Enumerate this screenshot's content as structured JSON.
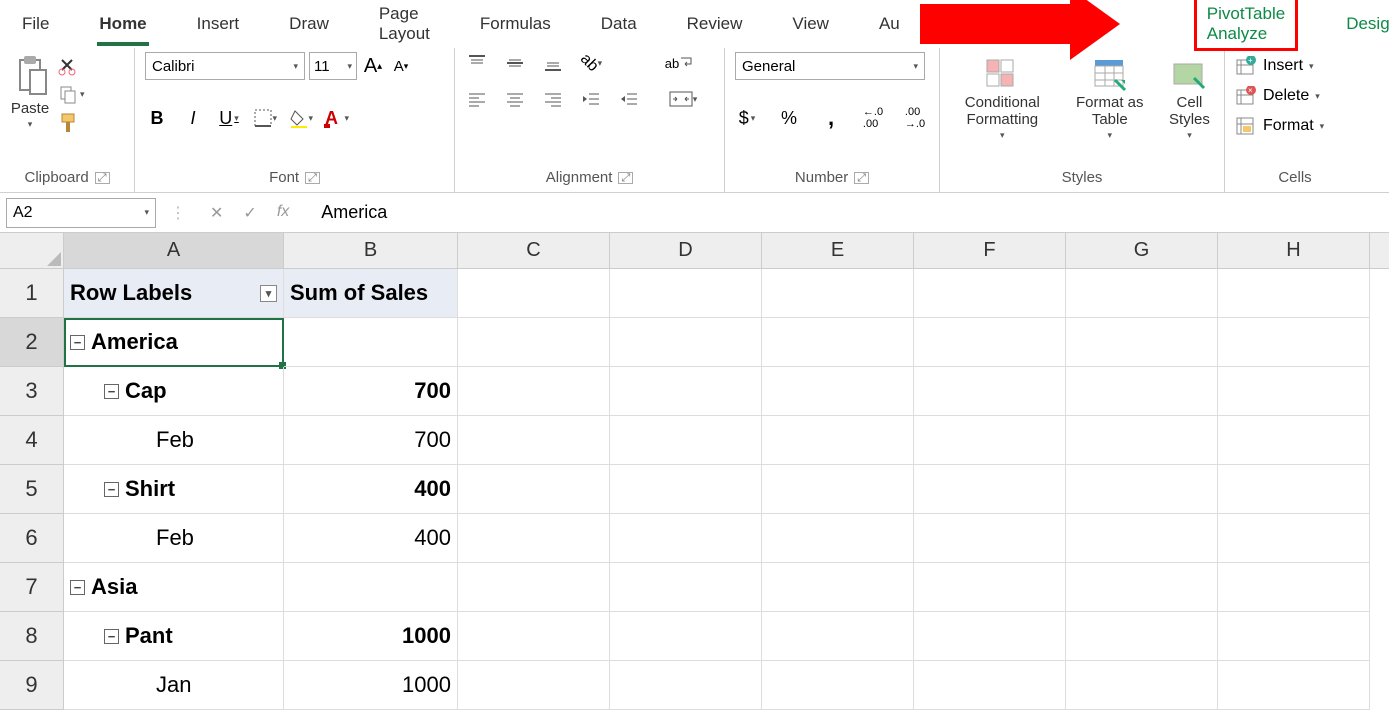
{
  "tabs": {
    "file": "File",
    "home": "Home",
    "insert": "Insert",
    "draw": "Draw",
    "page_layout": "Page Layout",
    "formulas": "Formulas",
    "data": "Data",
    "review": "Review",
    "view": "View",
    "au": "Au",
    "pivot_analyze": "PivotTable Analyze",
    "design": "Design"
  },
  "clipboard": {
    "paste": "Paste",
    "label": "Clipboard"
  },
  "font": {
    "name": "Calibri",
    "size": "11",
    "label": "Font",
    "bold": "B",
    "italic": "I",
    "underline": "U"
  },
  "alignment": {
    "label": "Alignment",
    "wrap": "ab"
  },
  "number": {
    "format": "General",
    "label": "Number",
    "dollar": "$",
    "percent": "%",
    "comma": ",",
    "inc": ".00",
    "dec": ".00"
  },
  "styles": {
    "conditional": "Conditional Formatting",
    "format_table": "Format as Table",
    "cell_styles": "Cell Styles",
    "label": "Styles"
  },
  "cells": {
    "insert": "Insert",
    "delete": "Delete",
    "format": "Format",
    "label": "Cells"
  },
  "namebox": "A2",
  "formula": "America",
  "fx": "fx",
  "columns": [
    "A",
    "B",
    "C",
    "D",
    "E",
    "F",
    "G",
    "H"
  ],
  "rows": [
    {
      "n": "1",
      "a": "Row Labels",
      "b": "Sum of Sales",
      "hdr": true,
      "dd": true
    },
    {
      "n": "2",
      "a": "America",
      "b": "",
      "bold": true,
      "collapse": true,
      "indent": 0,
      "selected": true
    },
    {
      "n": "3",
      "a": "Cap",
      "b": "700",
      "bold": true,
      "collapse": true,
      "indent": 1
    },
    {
      "n": "4",
      "a": "Feb",
      "b": "700",
      "indent": 2
    },
    {
      "n": "5",
      "a": "Shirt",
      "b": "400",
      "bold": true,
      "collapse": true,
      "indent": 1
    },
    {
      "n": "6",
      "a": "Feb",
      "b": "400",
      "indent": 2
    },
    {
      "n": "7",
      "a": "Asia",
      "b": "",
      "bold": true,
      "collapse": true,
      "indent": 0
    },
    {
      "n": "8",
      "a": "Pant",
      "b": "1000",
      "bold": true,
      "collapse": true,
      "indent": 1
    },
    {
      "n": "9",
      "a": "Jan",
      "b": "1000",
      "indent": 2
    }
  ]
}
